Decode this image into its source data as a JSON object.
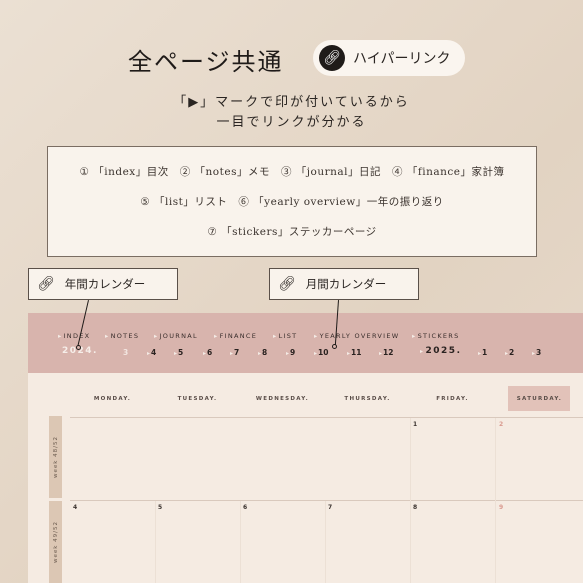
{
  "header": {
    "title": "全ページ共通",
    "pill_label": "ハイパーリンク",
    "pill_icon": "link-icon"
  },
  "subtitle": {
    "line1": "「▶」マークで印が付いているから",
    "line2": "一目でリンクが分かる"
  },
  "legend": {
    "line1": "① 「index」目次　② 「notes」メモ　③ 「journal」日記　④ 「finance」家計簿",
    "line2": "⑤ 「list」リスト　⑥ 「yearly overview」一年の振り返り",
    "line3": "⑦ 「stickers」ステッカーページ"
  },
  "callouts": [
    {
      "label": "年間カレンダー",
      "icon": "link-icon"
    },
    {
      "label": "月間カレンダー",
      "icon": "link-icon"
    }
  ],
  "calendar": {
    "nav": [
      "INDEX",
      "NOTES",
      "JOURNAL",
      "FINANCE",
      "LIST",
      "YEARLY OVERVIEW",
      "STICKERS"
    ],
    "year1": "2024.",
    "months1": [
      "3",
      "4",
      "5",
      "6",
      "7",
      "8",
      "9",
      "10",
      "11",
      "12"
    ],
    "year2": "2025.",
    "months2": [
      "1",
      "2",
      "3"
    ],
    "days": [
      "MONDAY.",
      "TUESDAY.",
      "WEDNESDAY.",
      "THURSDAY.",
      "FRIDAY.",
      "SATURDAY."
    ],
    "weeks": [
      {
        "label": "week 48/52",
        "dates": [
          "",
          "",
          "",
          "",
          "1",
          "2"
        ]
      },
      {
        "label": "week 49/52",
        "dates": [
          "4",
          "5",
          "6",
          "7",
          "8",
          "9"
        ]
      }
    ],
    "colors": {
      "header": "#d8b4ad",
      "saturday": "#e2c2b9",
      "weekend_date": "#d99a8f"
    }
  }
}
